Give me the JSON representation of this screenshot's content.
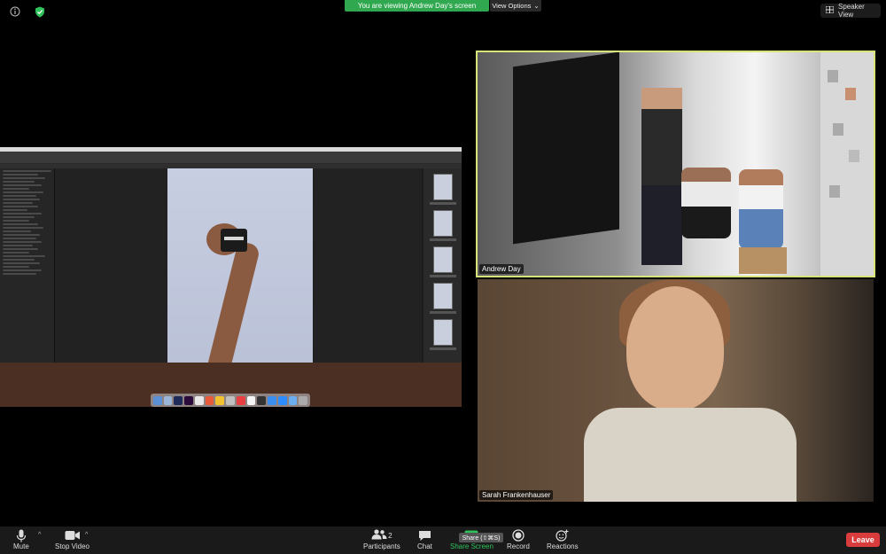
{
  "top": {
    "banner_text": "You are viewing Andrew Day's screen",
    "view_options_label": "View Options",
    "speaker_view_label": "Speaker View"
  },
  "participants": [
    {
      "name": "Andrew Day",
      "active_speaker": true
    },
    {
      "name": "Sarah Frankenhauser",
      "active_speaker": false
    }
  ],
  "toolbar": {
    "mute_label": "Mute",
    "stop_video_label": "Stop Video",
    "participants_label": "Participants",
    "participants_count": "2",
    "chat_label": "Chat",
    "share_screen_label": "Share Screen",
    "share_tooltip": "Share (⇧⌘S)",
    "record_label": "Record",
    "reactions_label": "Reactions",
    "leave_label": "Leave"
  },
  "colors": {
    "banner_green": "#2fa84f",
    "active_speaker_border": "#d8e37a",
    "share_green": "#2fc25b",
    "leave_red": "#d83c3c"
  },
  "icons": {
    "info": "info-icon",
    "security": "shield-check-icon",
    "speaker_view": "grid-icon",
    "mute": "microphone-icon",
    "video": "video-camera-icon",
    "participants": "people-icon",
    "chat": "chat-bubble-icon",
    "share": "share-screen-icon",
    "record": "record-icon",
    "reactions": "smiley-plus-icon"
  }
}
